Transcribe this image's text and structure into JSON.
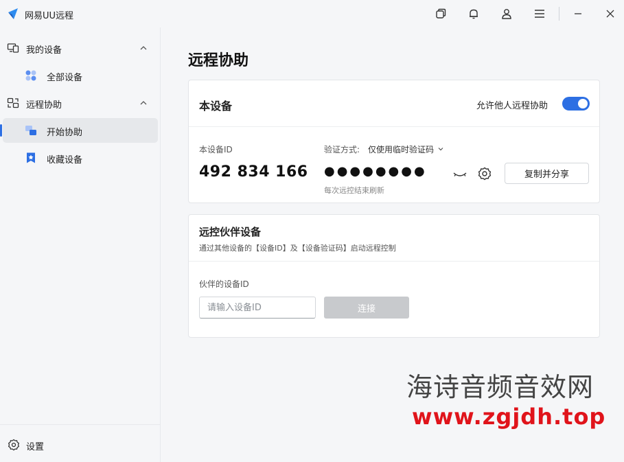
{
  "app": {
    "title": "网易UU远程"
  },
  "sidebar": {
    "groups": [
      {
        "label": "我的设备",
        "items": [
          {
            "label": "全部设备"
          }
        ]
      },
      {
        "label": "远程协助",
        "items": [
          {
            "label": "开始协助"
          },
          {
            "label": "收藏设备"
          }
        ]
      }
    ],
    "settings_label": "设置"
  },
  "main": {
    "page_title": "远程协助",
    "this_device": {
      "title": "本设备",
      "allow_label": "允许他人远程协助",
      "allow_enabled": true,
      "device_id_label": "本设备ID",
      "device_id": "492 834 166",
      "verify_label": "验证方式:",
      "verify_mode": "仅使用临时验证码",
      "password_mask": "●●●●●●●●",
      "refresh_note": "每次远控结束刷新",
      "copy_button": "复制并分享"
    },
    "partner_device": {
      "title": "远控伙伴设备",
      "subtitle": "通过其他设备的【设备ID】及【设备验证码】启动远程控制",
      "id_label": "伙伴的设备ID",
      "input_placeholder": "请输入设备ID",
      "connect_button": "连接"
    }
  },
  "watermark": {
    "line1": "海诗音频音效网",
    "line2": "www.zgjdh.top"
  },
  "colors": {
    "accent": "#2d6fe3",
    "disabled_button": "#c8cacd",
    "watermark_red": "#e0141b"
  }
}
